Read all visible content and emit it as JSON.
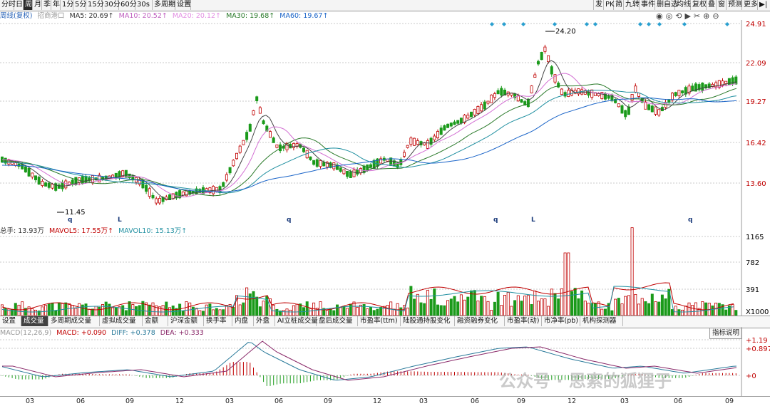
{
  "toolbar": {
    "left": [
      {
        "label": "分时",
        "active": false
      },
      {
        "label": "日",
        "active": false
      },
      {
        "label": "周",
        "active": true
      },
      {
        "label": "月",
        "active": false
      },
      {
        "label": "季",
        "active": false
      },
      {
        "label": "年",
        "active": false
      },
      {
        "label": "1分",
        "active": false
      },
      {
        "label": "5分",
        "active": false
      },
      {
        "label": "15分",
        "active": false
      },
      {
        "label": "30分",
        "active": false
      },
      {
        "label": "60分",
        "active": false
      },
      {
        "label": "30s",
        "active": false
      },
      {
        "label": "多周期",
        "active": false
      },
      {
        "label": "设置",
        "active": false
      }
    ],
    "right": [
      "发",
      "PK",
      "简",
      "九转",
      "事件",
      "删自选",
      "均线",
      "复权",
      "叠",
      "窗",
      "预测",
      "更多"
    ],
    "nav_arrow": "▶|"
  },
  "price_info": {
    "period": "周线(复权)",
    "stock": "招商港口",
    "ma5": "MA5: 20.69↑",
    "ma10": "MA10: 20.52↑",
    "ma20": "MA20: 20.12↑",
    "ma30": "MA30: 19.68↑",
    "ma60": "MA60: 19.67↑"
  },
  "price_axis": [
    "24.91",
    "22.09",
    "19.27",
    "16.42",
    "13.60"
  ],
  "price_annotations": {
    "high": "24.20",
    "low": "11.45"
  },
  "event_markers": {
    "q": "q",
    "l": "L"
  },
  "volume_info": {
    "total": "总手: 13.93万",
    "mavol5": "MAVOL5: 17.55万↑",
    "mavol10": "MAVOL10: 15.13万↑"
  },
  "volume_axis": [
    "1165",
    "782",
    "391"
  ],
  "volume_unit": "X1000",
  "tabs": [
    "设置",
    "成交量",
    "多周期成交量",
    "虚拟成交量",
    "金额",
    "沪深金额",
    "换手率",
    "内盘",
    "外盘",
    "AI立桩成交量",
    "盘后成交量",
    "市盈率(ttm)",
    "陆股通持股变化",
    "融资融券变化",
    "市盈率(动)",
    "市净率(pb)",
    "机构探测器"
  ],
  "active_tab": "成交量",
  "macd_info": {
    "name": "MACD(12,26,9)",
    "macd": "MACD: +0.090",
    "diff": "DIFF: +0.378",
    "dea": "DEA: +0.333"
  },
  "indicator_help": "指标说明",
  "macd_axis": [
    "+1.19",
    "+0.897",
    "+0"
  ],
  "months": [
    "03",
    "06",
    "09",
    "12",
    "03",
    "06",
    "09",
    "12",
    "03",
    "06",
    "09",
    "12",
    "03",
    "06",
    "09"
  ],
  "watermark": "公众号 · 思索的狐狸子",
  "colors": {
    "up": "#c00000",
    "down": "#1a9a1a",
    "ma5": "#444444",
    "ma10": "#d36fd3",
    "ma20": "#2a7a2a",
    "ma30": "#1f8fa0",
    "ma60": "#1a64c8",
    "diff": "#2a7a9a",
    "dea": "#8a2a6a",
    "accent": "#c00000"
  }
}
